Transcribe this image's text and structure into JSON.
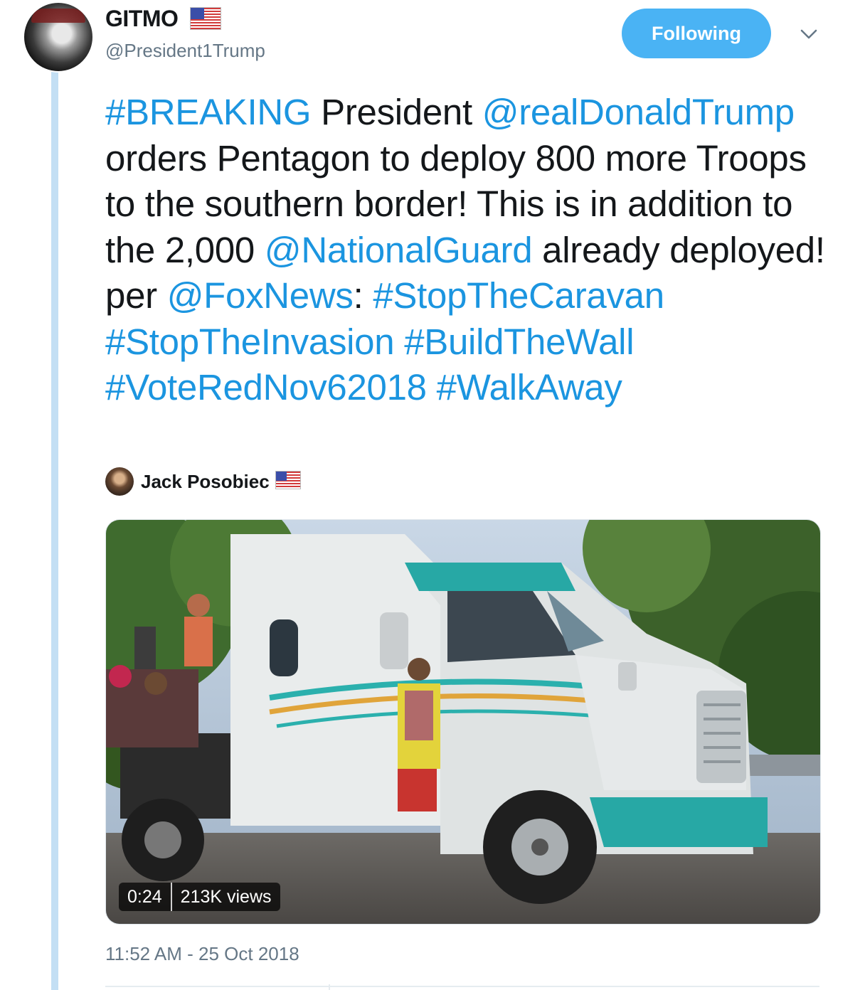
{
  "author": {
    "name": "GITMO",
    "handle": "@President1Trump"
  },
  "follow_button": {
    "label": "Following"
  },
  "icons": {
    "menu": "chevron-down-icon",
    "flag": "us-flag-icon"
  },
  "tweet": {
    "segments": [
      {
        "text": "#BREAKING",
        "link": true
      },
      {
        "text": " President ",
        "link": false
      },
      {
        "text": "@realDonaldTrump",
        "link": true
      },
      {
        "text": " orders Pentagon to deploy 800 more Troops to the southern border! This is in addition to the 2,000 ",
        "link": false
      },
      {
        "text": "@NationalGuard",
        "link": true
      },
      {
        "text": " already deployed! per ",
        "link": false
      },
      {
        "text": "@FoxNews",
        "link": true
      },
      {
        "text": ": ",
        "link": false
      },
      {
        "text": "#StopTheCaravan",
        "link": true
      },
      {
        "text": " ",
        "link": false
      },
      {
        "text": "#StopTheInvasion",
        "link": true
      },
      {
        "text": " ",
        "link": false
      },
      {
        "text": "#BuildTheWall",
        "link": true
      },
      {
        "text": " ",
        "link": false
      },
      {
        "text": "#VoteRedNov62018",
        "link": true
      },
      {
        "text": " ",
        "link": false
      },
      {
        "text": "#WalkAway",
        "link": true
      }
    ]
  },
  "quoted_user": {
    "name": "Jack Posobiec"
  },
  "video": {
    "duration": "0:24",
    "views": "213K views"
  },
  "timestamp": "11:52 AM - 25 Oct 2018",
  "colors": {
    "link": "#1b95e0",
    "follow_button": "#4ab3f4",
    "thread_line": "#c3dff4",
    "muted": "#657786"
  }
}
